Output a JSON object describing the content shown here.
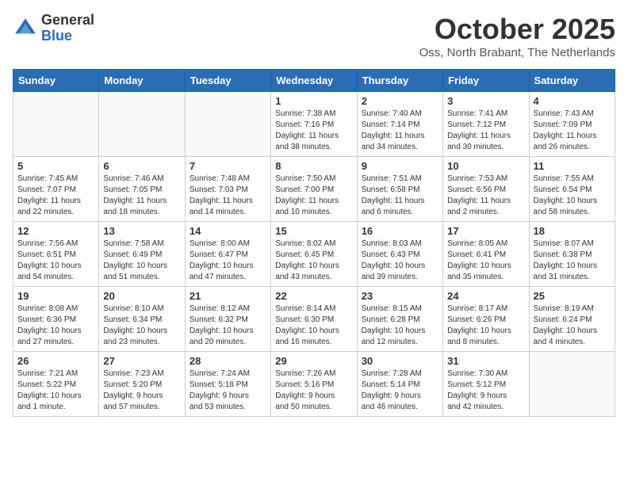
{
  "logo": {
    "general": "General",
    "blue": "Blue"
  },
  "title": "October 2025",
  "location": "Oss, North Brabant, The Netherlands",
  "weekdays": [
    "Sunday",
    "Monday",
    "Tuesday",
    "Wednesday",
    "Thursday",
    "Friday",
    "Saturday"
  ],
  "weeks": [
    [
      {
        "day": "",
        "info": ""
      },
      {
        "day": "",
        "info": ""
      },
      {
        "day": "",
        "info": ""
      },
      {
        "day": "1",
        "info": "Sunrise: 7:38 AM\nSunset: 7:16 PM\nDaylight: 11 hours\nand 38 minutes."
      },
      {
        "day": "2",
        "info": "Sunrise: 7:40 AM\nSunset: 7:14 PM\nDaylight: 11 hours\nand 34 minutes."
      },
      {
        "day": "3",
        "info": "Sunrise: 7:41 AM\nSunset: 7:12 PM\nDaylight: 11 hours\nand 30 minutes."
      },
      {
        "day": "4",
        "info": "Sunrise: 7:43 AM\nSunset: 7:09 PM\nDaylight: 11 hours\nand 26 minutes."
      }
    ],
    [
      {
        "day": "5",
        "info": "Sunrise: 7:45 AM\nSunset: 7:07 PM\nDaylight: 11 hours\nand 22 minutes."
      },
      {
        "day": "6",
        "info": "Sunrise: 7:46 AM\nSunset: 7:05 PM\nDaylight: 11 hours\nand 18 minutes."
      },
      {
        "day": "7",
        "info": "Sunrise: 7:48 AM\nSunset: 7:03 PM\nDaylight: 11 hours\nand 14 minutes."
      },
      {
        "day": "8",
        "info": "Sunrise: 7:50 AM\nSunset: 7:00 PM\nDaylight: 11 hours\nand 10 minutes."
      },
      {
        "day": "9",
        "info": "Sunrise: 7:51 AM\nSunset: 6:58 PM\nDaylight: 11 hours\nand 6 minutes."
      },
      {
        "day": "10",
        "info": "Sunrise: 7:53 AM\nSunset: 6:56 PM\nDaylight: 11 hours\nand 2 minutes."
      },
      {
        "day": "11",
        "info": "Sunrise: 7:55 AM\nSunset: 6:54 PM\nDaylight: 10 hours\nand 58 minutes."
      }
    ],
    [
      {
        "day": "12",
        "info": "Sunrise: 7:56 AM\nSunset: 6:51 PM\nDaylight: 10 hours\nand 54 minutes."
      },
      {
        "day": "13",
        "info": "Sunrise: 7:58 AM\nSunset: 6:49 PM\nDaylight: 10 hours\nand 51 minutes."
      },
      {
        "day": "14",
        "info": "Sunrise: 8:00 AM\nSunset: 6:47 PM\nDaylight: 10 hours\nand 47 minutes."
      },
      {
        "day": "15",
        "info": "Sunrise: 8:02 AM\nSunset: 6:45 PM\nDaylight: 10 hours\nand 43 minutes."
      },
      {
        "day": "16",
        "info": "Sunrise: 8:03 AM\nSunset: 6:43 PM\nDaylight: 10 hours\nand 39 minutes."
      },
      {
        "day": "17",
        "info": "Sunrise: 8:05 AM\nSunset: 6:41 PM\nDaylight: 10 hours\nand 35 minutes."
      },
      {
        "day": "18",
        "info": "Sunrise: 8:07 AM\nSunset: 6:38 PM\nDaylight: 10 hours\nand 31 minutes."
      }
    ],
    [
      {
        "day": "19",
        "info": "Sunrise: 8:08 AM\nSunset: 6:36 PM\nDaylight: 10 hours\nand 27 minutes."
      },
      {
        "day": "20",
        "info": "Sunrise: 8:10 AM\nSunset: 6:34 PM\nDaylight: 10 hours\nand 23 minutes."
      },
      {
        "day": "21",
        "info": "Sunrise: 8:12 AM\nSunset: 6:32 PM\nDaylight: 10 hours\nand 20 minutes."
      },
      {
        "day": "22",
        "info": "Sunrise: 8:14 AM\nSunset: 6:30 PM\nDaylight: 10 hours\nand 16 minutes."
      },
      {
        "day": "23",
        "info": "Sunrise: 8:15 AM\nSunset: 6:28 PM\nDaylight: 10 hours\nand 12 minutes."
      },
      {
        "day": "24",
        "info": "Sunrise: 8:17 AM\nSunset: 6:26 PM\nDaylight: 10 hours\nand 8 minutes."
      },
      {
        "day": "25",
        "info": "Sunrise: 8:19 AM\nSunset: 6:24 PM\nDaylight: 10 hours\nand 4 minutes."
      }
    ],
    [
      {
        "day": "26",
        "info": "Sunrise: 7:21 AM\nSunset: 5:22 PM\nDaylight: 10 hours\nand 1 minute."
      },
      {
        "day": "27",
        "info": "Sunrise: 7:23 AM\nSunset: 5:20 PM\nDaylight: 9 hours\nand 57 minutes."
      },
      {
        "day": "28",
        "info": "Sunrise: 7:24 AM\nSunset: 5:18 PM\nDaylight: 9 hours\nand 53 minutes."
      },
      {
        "day": "29",
        "info": "Sunrise: 7:26 AM\nSunset: 5:16 PM\nDaylight: 9 hours\nand 50 minutes."
      },
      {
        "day": "30",
        "info": "Sunrise: 7:28 AM\nSunset: 5:14 PM\nDaylight: 9 hours\nand 46 minutes."
      },
      {
        "day": "31",
        "info": "Sunrise: 7:30 AM\nSunset: 5:12 PM\nDaylight: 9 hours\nand 42 minutes."
      },
      {
        "day": "",
        "info": ""
      }
    ]
  ]
}
